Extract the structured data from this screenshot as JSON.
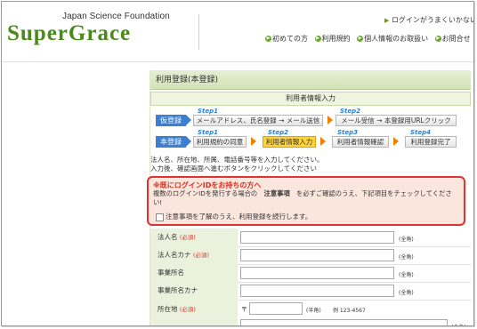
{
  "header": {
    "foundation": "Japan Science Foundation",
    "logo": "SuperGrace",
    "help_link": "ログインがうまくいかない時",
    "nav": [
      {
        "label": "初めての方",
        "icon": "arrow-right-circle-icon"
      },
      {
        "label": "利用規約",
        "icon": "arrow-right-circle-icon"
      },
      {
        "label": "個人情報のお取扱い",
        "icon": "arrow-right-circle-icon"
      },
      {
        "label": "お問合せ",
        "icon": "arrow-right-circle-icon"
      }
    ]
  },
  "panel": {
    "title": "利用登録(本登録)",
    "section": "利用者情報入力"
  },
  "steps": {
    "provisional_tag": "仮登録",
    "main_tag": "本登録",
    "step1_no": "Step1",
    "step1": "メールアドレス、氏名登録 → メール送信",
    "step2_no": "Step2",
    "step2": "メール受信 → 本登録用URLクリック",
    "main": [
      {
        "no": "Step1",
        "label": "利用規約の同意"
      },
      {
        "no": "Step2",
        "label": "利用者情報入力"
      },
      {
        "no": "Step3",
        "label": "利用者情報確認"
      },
      {
        "no": "Step4",
        "label": "利用登録完了"
      }
    ]
  },
  "instructions": {
    "line1": "法人名、所在地、所属、電話番号等を入力してください。",
    "line2": "入力後、確認画面へ進むボタンをクリックしてください"
  },
  "notice": {
    "title": "※既にログインIDをお持ちの方へ",
    "text_before": "複数のログインIDを発行する場合の",
    "text_bold": "注意事項",
    "text_after": "を必ずご確認のうえ、下記項目をチェックしてください!",
    "checkbox_label": "注意事項を了解のうえ、利用登録を続行します。"
  },
  "form": {
    "required_label": "(必須)",
    "fullwidth_hint": "(全角)",
    "halfwidth_hint": "(半角)",
    "postal_example": "例 123-4567",
    "postal_mark": "〒",
    "rows": {
      "corp_name": "法人名",
      "corp_kana": "法人名カナ",
      "office": "事業所名",
      "office_kana": "事業所名カナ",
      "address": "所在地"
    }
  },
  "colors": {
    "logo_green": "#4a8a1c",
    "step_blue": "#3a7fd0",
    "active_step": "#ffd43b",
    "notice_border": "#e23232"
  }
}
